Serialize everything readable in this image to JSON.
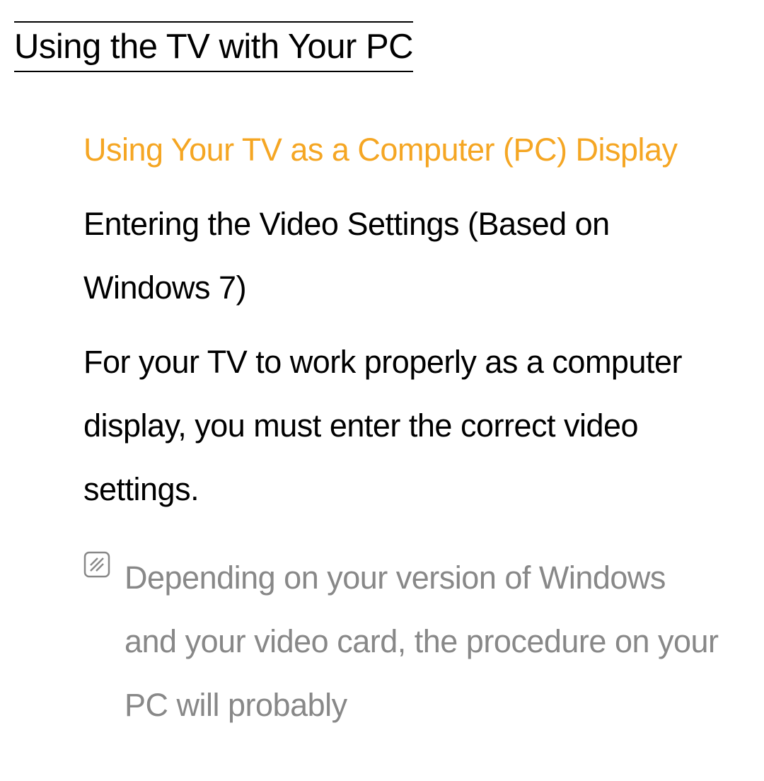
{
  "title": "Using the TV with Your PC",
  "content": {
    "section_heading": "Using Your TV as a Computer (PC) Display",
    "sub_heading": "Entering the Video Settings (Based on Windows 7)",
    "body_text": "For your TV to work properly as a computer display, you must enter the correct video settings.",
    "note": {
      "icon_name": "note-icon",
      "text": "Depending on your version of Windows and your video card, the procedure on your PC will probably"
    }
  }
}
